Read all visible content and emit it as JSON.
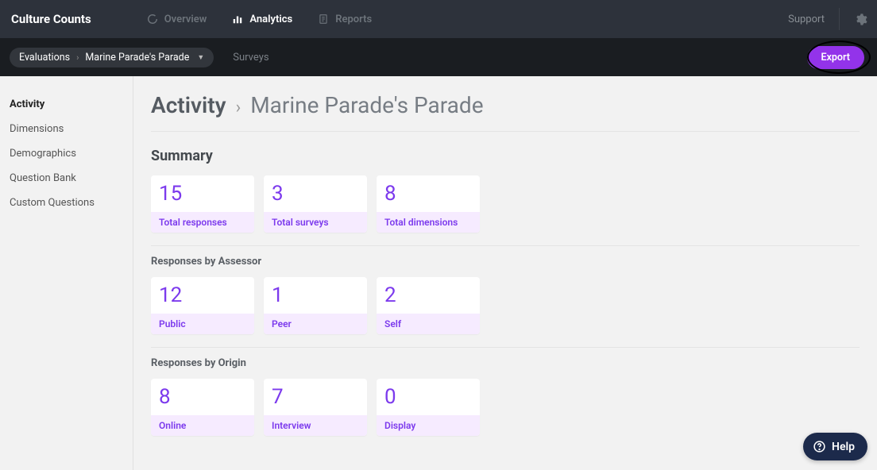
{
  "brand": "Culture Counts",
  "nav": {
    "overview": "Overview",
    "analytics": "Analytics",
    "reports": "Reports",
    "support": "Support"
  },
  "subnav": {
    "crumb1": "Evaluations",
    "crumb2": "Marine Parade's Parade",
    "surveys": "Surveys",
    "export": "Export"
  },
  "sidebar": {
    "activity": "Activity",
    "dimensions": "Dimensions",
    "demographics": "Demographics",
    "questionBank": "Question Bank",
    "customQuestions": "Custom Questions"
  },
  "heading": {
    "activity": "Activity",
    "name": "Marine Parade's Parade"
  },
  "summary": {
    "title": "Summary",
    "cards": [
      {
        "value": "15",
        "label": "Total responses"
      },
      {
        "value": "3",
        "label": "Total surveys"
      },
      {
        "value": "8",
        "label": "Total dimensions"
      }
    ]
  },
  "assessor": {
    "title": "Responses by Assessor",
    "cards": [
      {
        "value": "12",
        "label": "Public"
      },
      {
        "value": "1",
        "label": "Peer"
      },
      {
        "value": "2",
        "label": "Self"
      }
    ]
  },
  "origin": {
    "title": "Responses by Origin",
    "cards": [
      {
        "value": "8",
        "label": "Online"
      },
      {
        "value": "7",
        "label": "Interview"
      },
      {
        "value": "0",
        "label": "Display"
      }
    ]
  },
  "help": "Help"
}
